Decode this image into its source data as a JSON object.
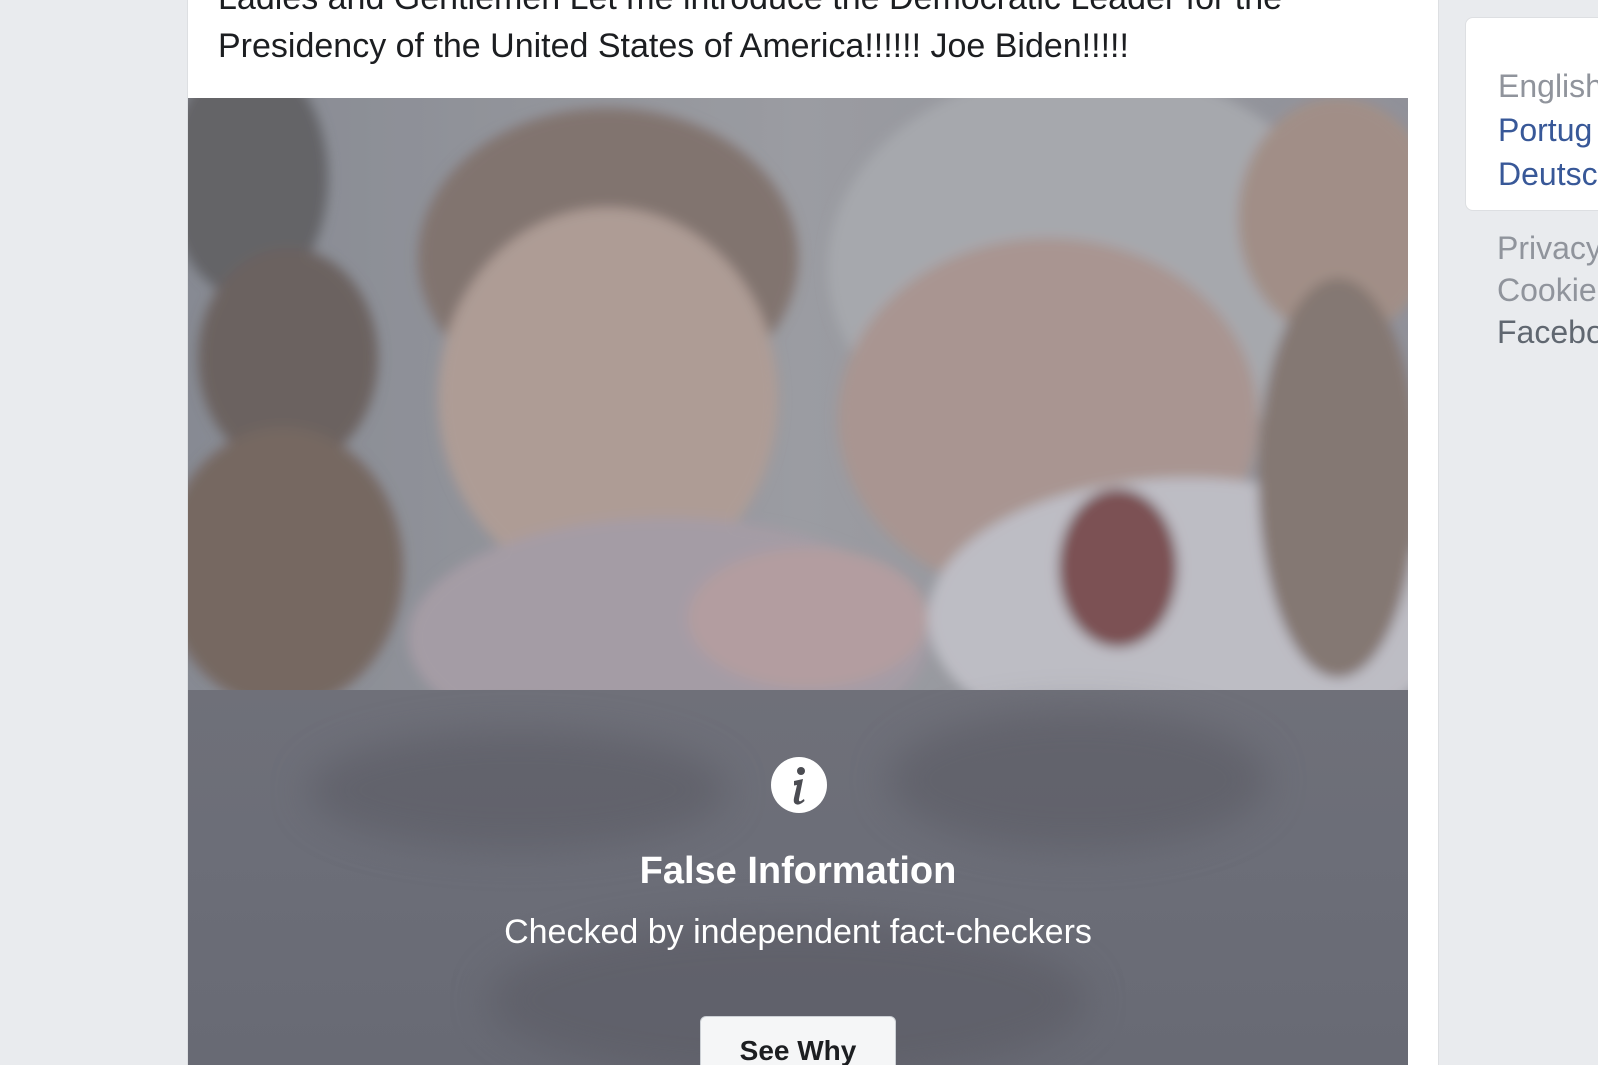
{
  "post": {
    "text_line1": "Ladies and Gentlemen Let me introduce the Democratic Leader for the",
    "text_line2": "Presidency of the United States of America!!!!!! Joe Biden!!!!!"
  },
  "warning": {
    "icon": "info-icon",
    "title": "False Information",
    "subtitle": "Checked by independent fact-checkers",
    "button_label": "See Why"
  },
  "sidebar": {
    "languages": [
      "English",
      "Portug",
      "Deutsc"
    ],
    "footer_links": [
      "Privacy",
      "Cookie"
    ],
    "footer_copy": "Facebo"
  },
  "colors": {
    "page_bg": "#e9ebee",
    "link": "#385898",
    "muted": "#90949c",
    "overlay": "#6c6e78"
  }
}
